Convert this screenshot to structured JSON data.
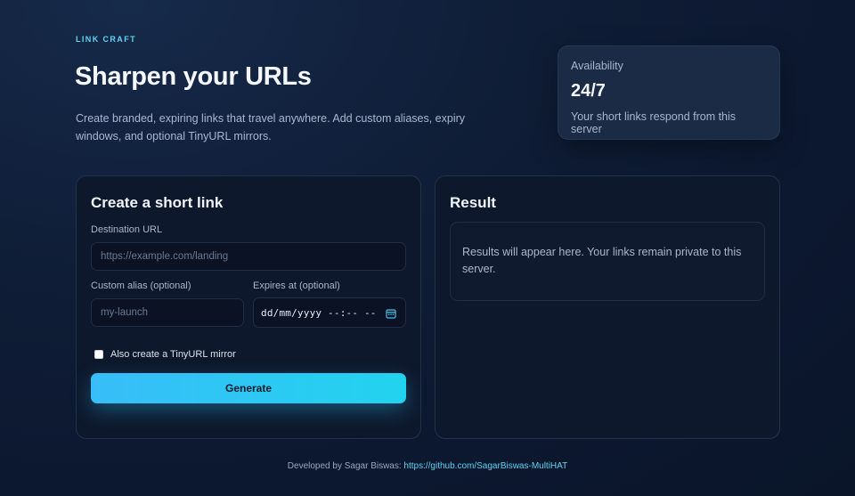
{
  "header": {
    "eyebrow": "LINK CRAFT",
    "title": "Sharpen your URLs",
    "subtitle": "Create branded, expiring links that travel anywhere. Add custom aliases, expiry windows, and optional TinyURL mirrors."
  },
  "availability": {
    "label": "Availability",
    "value": "24/7",
    "note": "Your short links respond from this server"
  },
  "form": {
    "title": "Create a short link",
    "destination_label": "Destination URL",
    "destination_placeholder": "https://example.com/landing",
    "destination_value": "",
    "alias_label": "Custom alias (optional)",
    "alias_placeholder": "my-launch",
    "alias_value": "",
    "expires_label": "Expires at (optional)",
    "expires_placeholder": "dd/mm/yyyy --:-- --",
    "tinyurl_label": "Also create a TinyURL mirror",
    "tinyurl_checked": false,
    "generate_label": "Generate",
    "icon": "calendar-icon"
  },
  "result": {
    "title": "Result",
    "message": "Results will appear here. Your links remain private to this server."
  },
  "footer": {
    "prefix": "Developed by Sagar Biswas: ",
    "link_text": "https://github.com/SagarBiswas-MultiHAT"
  },
  "colors": {
    "accent": "#38bdf8",
    "accent_alt": "#22d3ee",
    "eyebrow": "#5fd4f0",
    "panel_bg": "#0e182c",
    "card_bg": "#1c2b45"
  }
}
